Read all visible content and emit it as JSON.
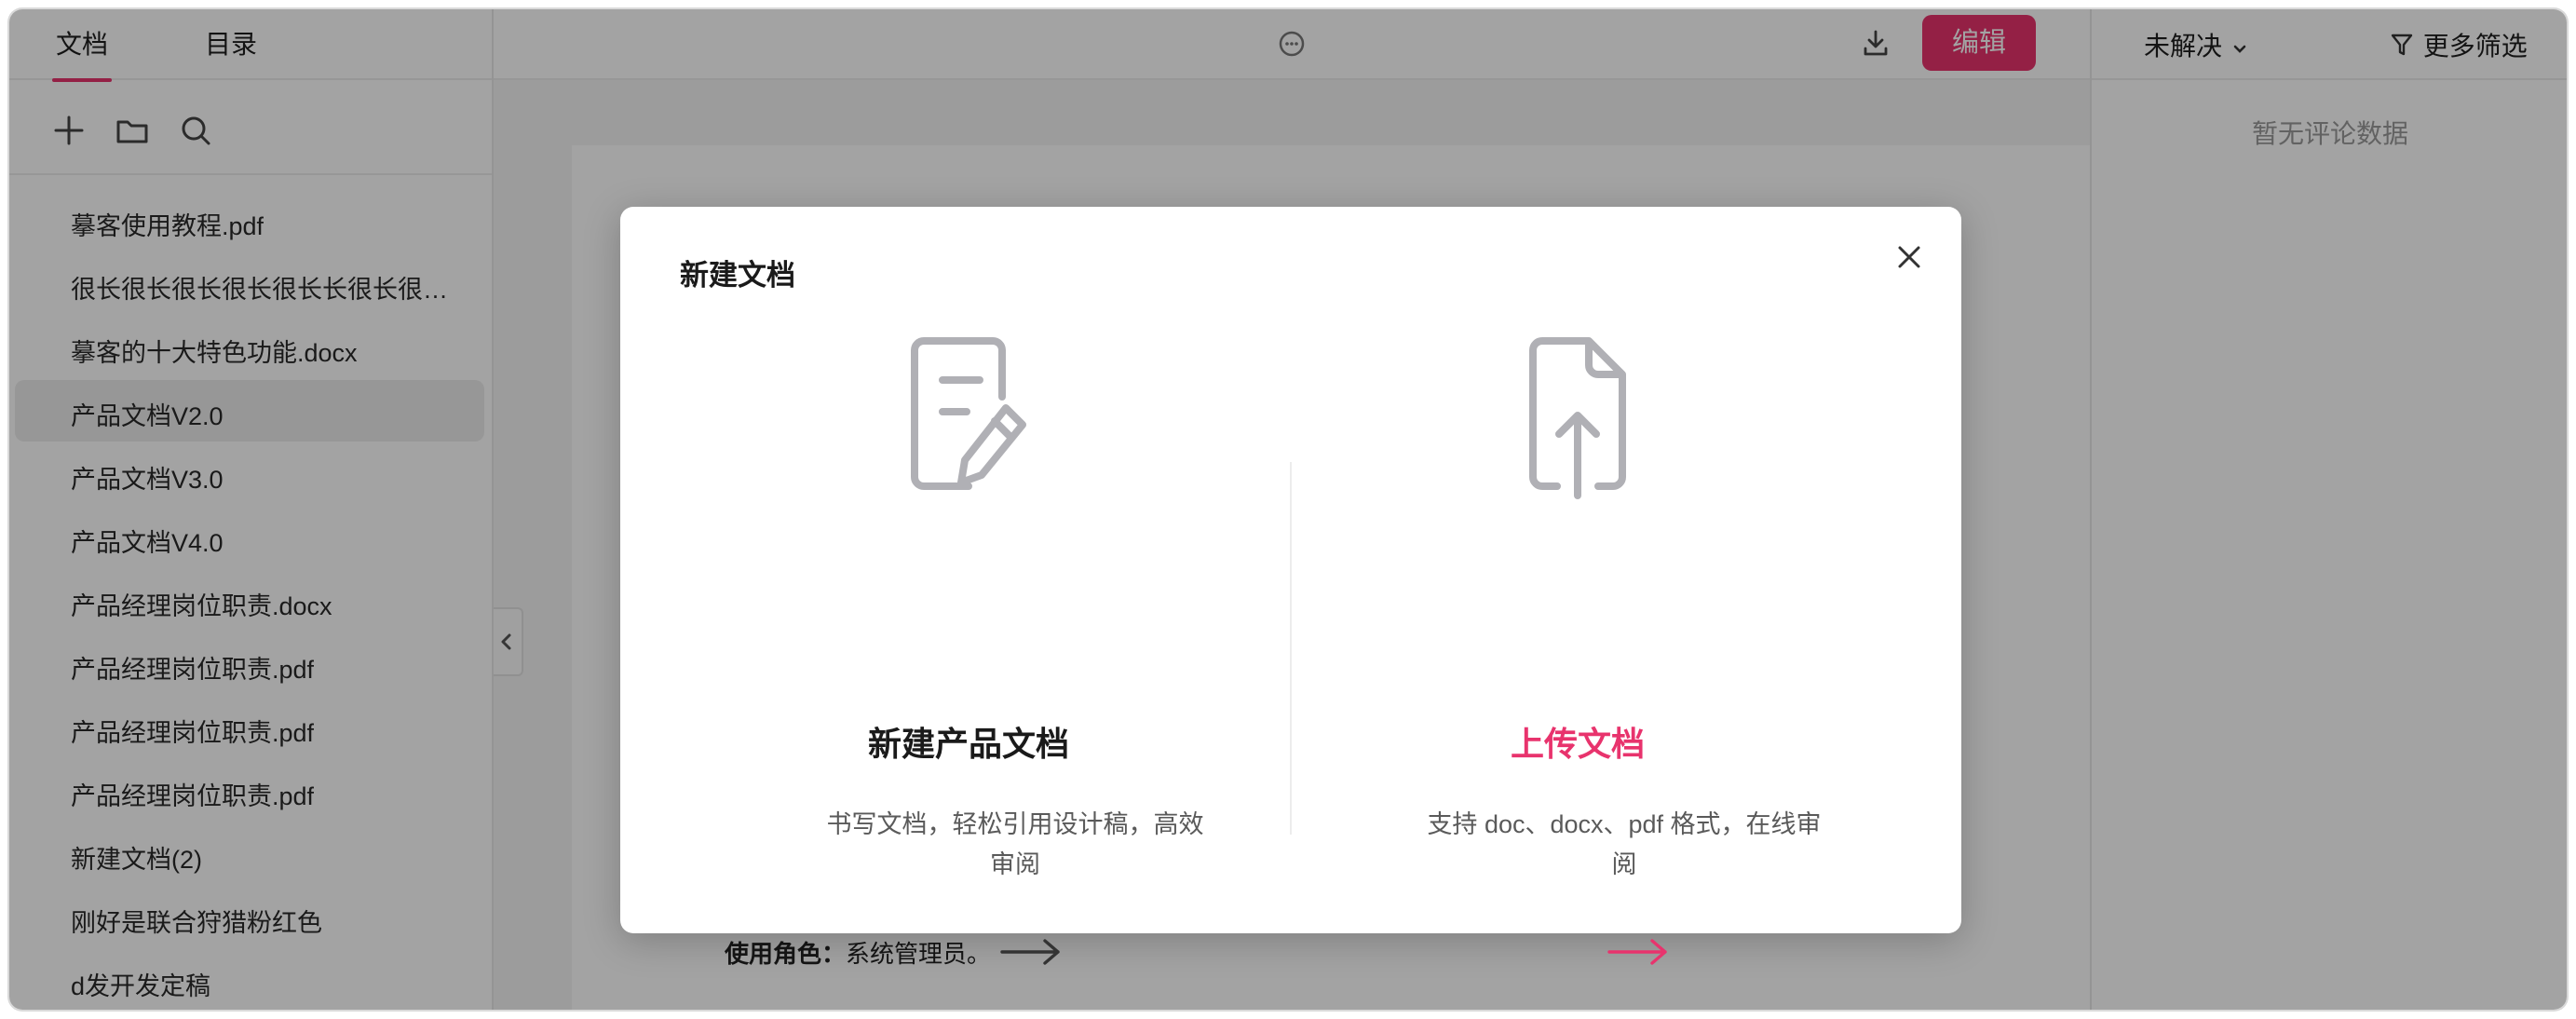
{
  "sidebar": {
    "tabs": [
      {
        "label": "文档"
      },
      {
        "label": "目录"
      }
    ],
    "files": [
      {
        "name": "摹客使用教程.pdf"
      },
      {
        "name": "很长很长很长很长很长长很长很长很长很长很长"
      },
      {
        "name": "摹客的十大特色功能.docx"
      },
      {
        "name": "产品文档V2.0"
      },
      {
        "name": "产品文档V3.0"
      },
      {
        "name": "产品文档V4.0"
      },
      {
        "name": "产品经理岗位职责.docx"
      },
      {
        "name": "产品经理岗位职责.pdf"
      },
      {
        "name": "产品经理岗位职责.pdf"
      },
      {
        "name": "产品经理岗位职责.pdf"
      },
      {
        "name": "新建文档(2)"
      },
      {
        "name": "刚好是联合狩猎粉红色"
      },
      {
        "name": "d发开发定稿"
      }
    ]
  },
  "header": {
    "edit_label": "编辑"
  },
  "comments": {
    "status_filter": "未解决",
    "more_filters": "更多筛选",
    "empty_text": "暂无评论数据"
  },
  "document": {
    "role_label": "使用角色：",
    "role_value": "系统管理员。"
  },
  "modal": {
    "title": "新建文档",
    "options": [
      {
        "title": "新建产品文档",
        "description": "书写文档，轻松引用设计稿，高效审阅",
        "icon": "document-edit-icon"
      },
      {
        "title": "上传文档",
        "description": "支持 doc、docx、pdf 格式，在线审阅",
        "icon": "file-upload-icon"
      }
    ]
  },
  "colors": {
    "accent": "#e8336d",
    "text_muted": "#5a5a5a",
    "icon_gray": "#b0b0b5"
  }
}
